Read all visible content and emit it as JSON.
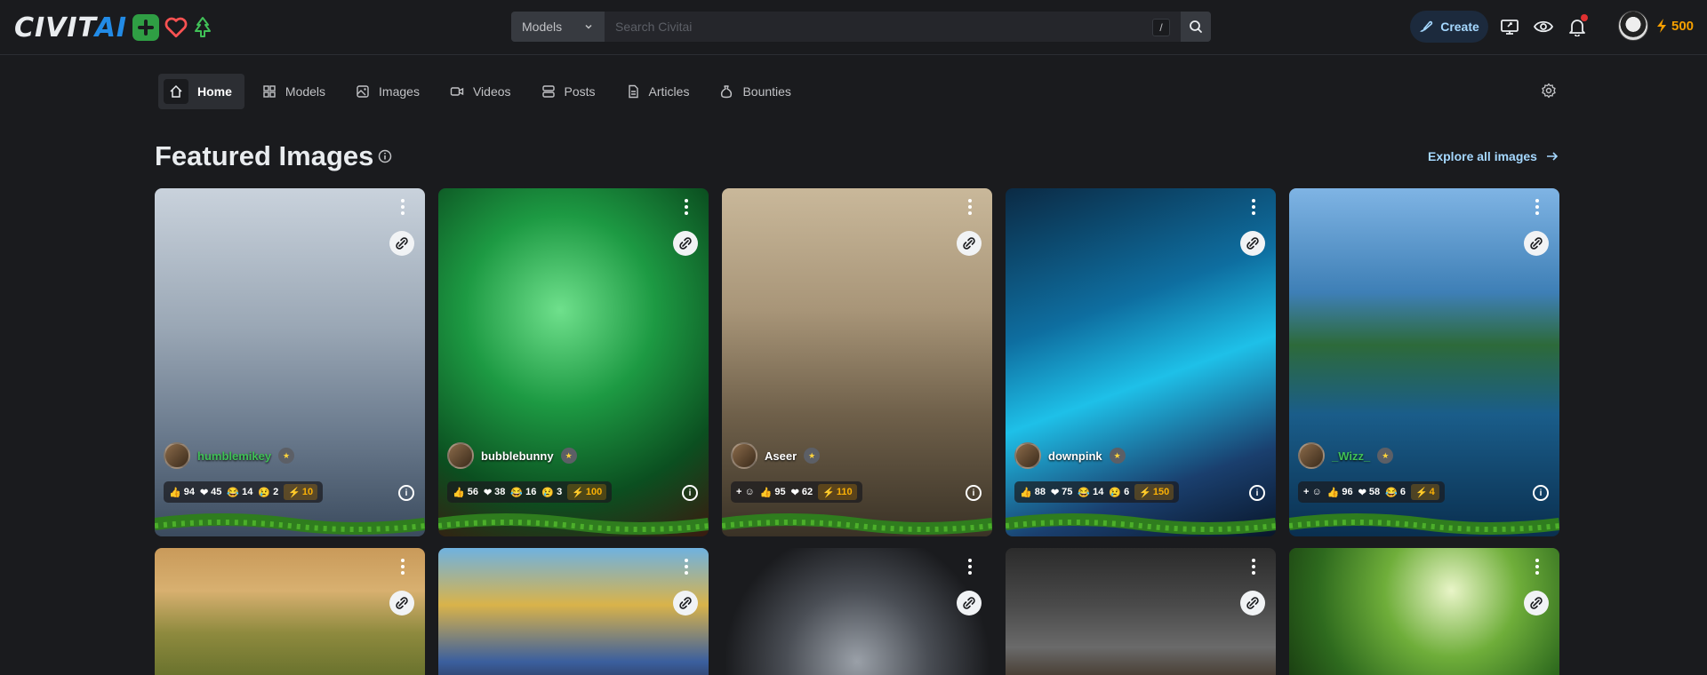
{
  "header": {
    "logo_main": "CIVIT",
    "logo_accent": "AI",
    "search": {
      "scope": "Models",
      "placeholder": "Search Civitai",
      "shortcut": "/"
    },
    "create_label": "Create",
    "buzz_amount": "500"
  },
  "nav": {
    "items": [
      {
        "label": "Home",
        "icon": "home-icon"
      },
      {
        "label": "Models",
        "icon": "grid-icon"
      },
      {
        "label": "Images",
        "icon": "photo-icon"
      },
      {
        "label": "Videos",
        "icon": "video-icon"
      },
      {
        "label": "Posts",
        "icon": "posts-icon"
      },
      {
        "label": "Articles",
        "icon": "article-icon"
      },
      {
        "label": "Bounties",
        "icon": "moneybag-icon"
      }
    ]
  },
  "featured": {
    "title": "Featured Images",
    "explore_label": "Explore all images"
  },
  "cards": [
    {
      "user": "humblemikey",
      "user_color": "#40c057",
      "likes": "94",
      "hearts": "45",
      "laughs": "14",
      "cries": "2",
      "buzz": "10",
      "add": false,
      "gradient": "linear-gradient(180deg,#c9d2dc 0%,#9aa7b5 40%,#6b7b8e 70%,#3b4b5e 100%)"
    },
    {
      "user": "bubblebunny",
      "user_color": "#ffffff",
      "likes": "56",
      "hearts": "38",
      "laughs": "16",
      "cries": "3",
      "buzz": "100",
      "add": false,
      "gradient": "radial-gradient(circle at 45% 35%,#6fe08c 0%,#1d9a43 35%,#0b4f20 70%,#3a1a10 100%)"
    },
    {
      "user": "Aseer",
      "user_color": "#ffffff",
      "likes": "95",
      "hearts": "62",
      "laughs": "",
      "cries": "",
      "buzz": "110",
      "add": true,
      "gradient": "linear-gradient(180deg,#c9b89a 0%,#a89578 35%,#6f604a 65%,#3a3226 100%)"
    },
    {
      "user": "downpink",
      "user_color": "#ffffff",
      "likes": "88",
      "hearts": "75",
      "laughs": "14",
      "cries": "6",
      "buzz": "150",
      "add": false,
      "gradient": "linear-gradient(160deg,#0b2a44 0%,#0e6ea0 35%,#1ec0e8 55%,#1a3f6e 80%,#09162a 100%)"
    },
    {
      "user": "_Wizz_",
      "user_color": "#40c057",
      "likes": "96",
      "hearts": "58",
      "laughs": "6",
      "cries": "",
      "buzz": "4",
      "add": true,
      "gradient": "linear-gradient(180deg,#7fb4e4 0%,#3e7fb6 30%,#2d6a3a 45%,#1a5d8a 65%,#0a2f4f 100%)"
    }
  ],
  "cards_row2": [
    {
      "gradient": "linear-gradient(180deg,#c99a5a 0%,#d8b070 30%,#8e8a3e 60%,#5d6a28 100%)"
    },
    {
      "gradient": "linear-gradient(180deg,#6fb2e0 0%,#d9b34a 40%,#3b5f9e 80%,#2a3550 100%)"
    },
    {
      "gradient": "radial-gradient(circle at 50% 80%,#9aa0a8 0%,#4a4e55 40%,#1a1b1e 75%)"
    },
    {
      "gradient": "linear-gradient(180deg,#2b2b2b 0%,#4a4a4a 40%,#6a6a6a 70%,#3a2a1a 100%)"
    },
    {
      "gradient": "radial-gradient(circle at 60% 30%,#e9f5c8 0%,#6fae3a 35%,#2e6a1e 70%,#183a10 100%)"
    }
  ]
}
